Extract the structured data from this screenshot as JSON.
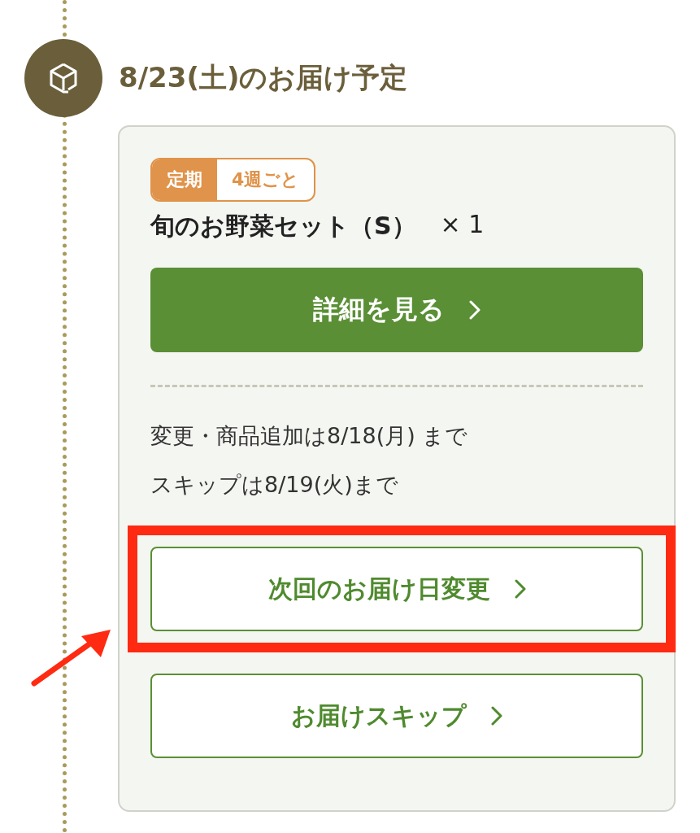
{
  "delivery": {
    "title": "8/23(土)のお届け予定"
  },
  "item": {
    "badge": {
      "type": "定期",
      "interval": "4週ごと"
    },
    "name": "旬のお野菜セット（S）",
    "quantity": "× 1"
  },
  "detail_button": {
    "label": "詳細を見る"
  },
  "deadlines": [
    "変更・商品追加は8/18(月) まで",
    "スキップは8/19(火)まで"
  ],
  "actions": [
    {
      "label": "次回のお届け日変更",
      "highlighted": true
    },
    {
      "label": "お届けスキップ",
      "highlighted": false
    }
  ]
}
